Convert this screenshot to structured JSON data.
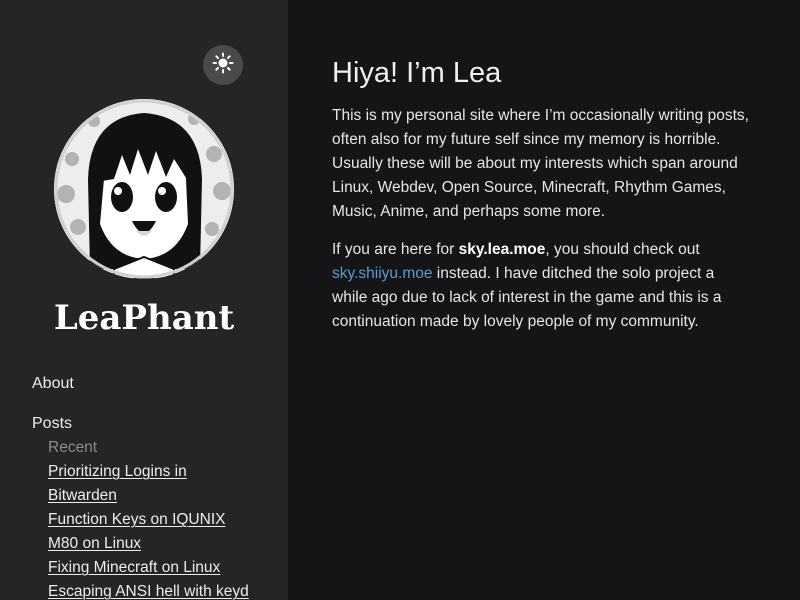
{
  "sidebar": {
    "theme_toggle_icon": "sun-icon",
    "site_title": "LeaPhant",
    "nav": {
      "about": "About",
      "posts": "Posts",
      "recent": "Recent",
      "links": [
        "Prioritizing Logins in Bitwarden",
        "Function Keys on IQUNIX",
        "M80 on Linux",
        "Fixing Minecraft on Linux",
        "Escaping ANSI hell with keyd"
      ]
    }
  },
  "main": {
    "heading": "Hiya! I’m Lea",
    "intro": "This is my personal site where I’m occasionally writing posts, often also for my future self since my memory is horrible. Usually these will be about my interests which span around Linux, Webdev, Open Source, Minecraft, Rhythm Games, Music, Anime, and perhaps some more.",
    "p2_before": "If you are here for ",
    "p2_bold": "sky.lea.moe",
    "p2_mid": ", you should check out ",
    "p2_link": "sky.shiiyu.moe",
    "p2_after": " instead. I have ditched the solo project a while ago due to lack of interest in the game and this is a continuation made by lovely people of my community."
  },
  "colors": {
    "sidebar_bg": "#252525",
    "main_bg": "#151416",
    "link": "#5b9bd5",
    "muted": "#8c8c8c"
  }
}
